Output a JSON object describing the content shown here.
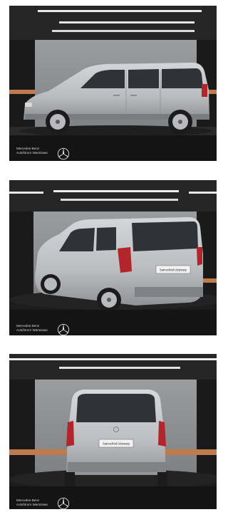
{
  "photos": [
    {
      "view": "side",
      "dealer_line1": "Mercedes-Benz",
      "dealer_line2": "Autoforum Warszawa",
      "logo_icon": "mercedes-star-icon"
    },
    {
      "view": "rear-three-quarter",
      "dealer_line1": "Mercedes-Benz",
      "dealer_line2": "Autoforum Warszawa",
      "plate_text": "Samochód Używany",
      "logo_icon": "mercedes-star-icon"
    },
    {
      "view": "rear",
      "dealer_line1": "Mercedes-Benz",
      "dealer_line2": "Autoforum Warszawa",
      "plate_text": "Samochód Używany",
      "logo_icon": "mercedes-star-icon"
    }
  ],
  "colors": {
    "car_body": "#c4c6c8",
    "background_wall": "#8d8f92",
    "floor": "#2b2b2b",
    "taillight": "#b2252a",
    "banner": "#141414"
  }
}
